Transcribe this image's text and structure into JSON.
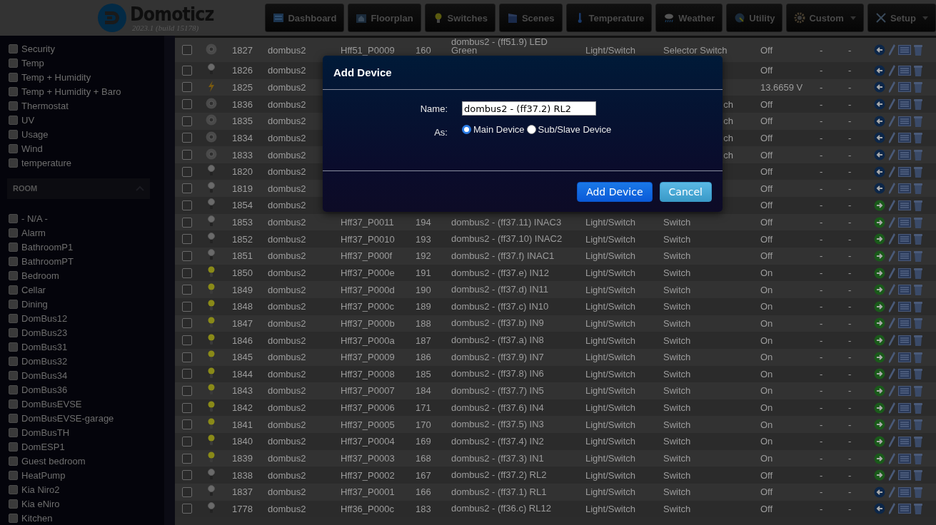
{
  "header": {
    "logo_text": "Domoticz",
    "version": "2023.1 (build 15178)",
    "nav": [
      {
        "label": "Dashboard",
        "kind": "dashboard",
        "dropdown": false
      },
      {
        "label": "Floorplan",
        "kind": "floorplan",
        "dropdown": false
      },
      {
        "label": "Switches",
        "kind": "switches",
        "dropdown": false
      },
      {
        "label": "Scenes",
        "kind": "scenes",
        "dropdown": false
      },
      {
        "label": "Temperature",
        "kind": "temperature",
        "dropdown": false
      },
      {
        "label": "Weather",
        "kind": "weather",
        "dropdown": false
      },
      {
        "label": "Utility",
        "kind": "utility",
        "dropdown": false
      },
      {
        "label": "Custom",
        "kind": "custom",
        "dropdown": true
      },
      {
        "label": "Setup",
        "kind": "setup",
        "dropdown": true
      }
    ]
  },
  "sidebar": {
    "type_items": [
      {
        "label": "Security",
        "checked": false
      },
      {
        "label": "Temp",
        "checked": false
      },
      {
        "label": "Temp + Humidity",
        "checked": false
      },
      {
        "label": "Temp + Humidity + Baro",
        "checked": false
      },
      {
        "label": "Thermostat",
        "checked": false
      },
      {
        "label": "UV",
        "checked": false
      },
      {
        "label": "Usage",
        "checked": false
      },
      {
        "label": "Wind",
        "checked": false
      },
      {
        "label": "temperature",
        "checked": false
      }
    ],
    "room_section": {
      "title": "ROOM",
      "expanded": true
    },
    "room_items": [
      {
        "label": "- N/A -",
        "checked": false
      },
      {
        "label": "Alarm",
        "checked": false
      },
      {
        "label": "BathroomP1",
        "checked": false
      },
      {
        "label": "BathroomPT",
        "checked": false
      },
      {
        "label": "Bedroom",
        "checked": false
      },
      {
        "label": "Cellar",
        "checked": false
      },
      {
        "label": "Dining",
        "checked": false
      },
      {
        "label": "DomBus12",
        "checked": false
      },
      {
        "label": "DomBus23",
        "checked": false
      },
      {
        "label": "DomBus31",
        "checked": false
      },
      {
        "label": "DomBus32",
        "checked": false
      },
      {
        "label": "DomBus34",
        "checked": false
      },
      {
        "label": "DomBus36",
        "checked": false
      },
      {
        "label": "DomBusEVSE",
        "checked": false
      },
      {
        "label": "DomBusEVSE-garage",
        "checked": false
      },
      {
        "label": "DomBusTH",
        "checked": false
      },
      {
        "label": "DomESP1",
        "checked": false
      },
      {
        "label": "Guest bedroom",
        "checked": false
      },
      {
        "label": "HeatPump",
        "checked": false
      },
      {
        "label": "Kia Niro2",
        "checked": false
      },
      {
        "label": "Kia eNiro",
        "checked": false
      },
      {
        "label": "Kitchen",
        "checked": false
      }
    ]
  },
  "table": {
    "rows": [
      {
        "checked": false,
        "kind": "selector",
        "idx": "1827",
        "hardware": "dombus2",
        "id": "Hff51_P0009",
        "unit": "160",
        "name": "dombus2 - (ff51.9) LED Green",
        "type": "Light/Switch",
        "subtype": "Selector Switch",
        "data": "Off",
        "column_11": "-",
        "column_12": "-",
        "used": true
      },
      {
        "checked": false,
        "kind": "bulb_off",
        "idx": "1826",
        "hardware": "dombus2",
        "data": "Off",
        "column_11": "-",
        "column_12": "-",
        "used": true
      },
      {
        "checked": false,
        "kind": "bolt",
        "idx": "1825",
        "hardware": "dombus2",
        "data": "13.6659 V",
        "column_11": "-",
        "column_12": "-",
        "used": true
      },
      {
        "checked": false,
        "kind": "selector",
        "idx": "1836",
        "hardware": "dombus2",
        "subtype_tail": "ch",
        "data": "Off",
        "column_11": "-",
        "column_12": "-",
        "used": true
      },
      {
        "checked": false,
        "kind": "selector",
        "idx": "1835",
        "hardware": "dombus2",
        "subtype_tail": "ch",
        "data": "Off",
        "column_11": "-",
        "column_12": "-",
        "used": true
      },
      {
        "checked": false,
        "kind": "selector",
        "idx": "1834",
        "hardware": "dombus2",
        "subtype_tail": "ch",
        "data": "Off",
        "column_11": "-",
        "column_12": "-",
        "used": true
      },
      {
        "checked": false,
        "kind": "selector",
        "idx": "1833",
        "hardware": "dombus2",
        "subtype_tail": "ch",
        "data": "Off",
        "column_11": "-",
        "column_12": "-",
        "used": true
      },
      {
        "checked": false,
        "kind": "bulb_off",
        "idx": "1820",
        "hardware": "dombus2",
        "data": "Off",
        "column_11": "-",
        "column_12": "-",
        "used": true
      },
      {
        "checked": false,
        "kind": "bulb_off",
        "idx": "1819",
        "hardware": "dombus2",
        "data": "Off",
        "column_11": "-",
        "column_12": "-",
        "used": true
      },
      {
        "checked": false,
        "kind": "bulb_off",
        "idx": "1854",
        "hardware": "dombus2",
        "data": "Off",
        "column_11": "-",
        "column_12": "-",
        "used": false
      },
      {
        "checked": false,
        "kind": "bulb_off",
        "idx": "1853",
        "hardware": "dombus2",
        "id": "Hff37_P0011",
        "unit": "194",
        "name": "dombus2 - (ff37.11) INAC3",
        "type": "Light/Switch",
        "subtype": "Switch",
        "data": "Off",
        "column_11": "-",
        "column_12": "-",
        "used": false
      },
      {
        "checked": false,
        "kind": "bulb_off",
        "idx": "1852",
        "hardware": "dombus2",
        "id": "Hff37_P0010",
        "unit": "193",
        "name": "dombus2 - (ff37.10) INAC2",
        "type": "Light/Switch",
        "subtype": "Switch",
        "data": "Off",
        "column_11": "-",
        "column_12": "-",
        "used": false
      },
      {
        "checked": false,
        "kind": "bulb_off",
        "idx": "1851",
        "hardware": "dombus2",
        "id": "Hff37_P000f",
        "unit": "192",
        "name": "dombus2 - (ff37.f) INAC1",
        "type": "Light/Switch",
        "subtype": "Switch",
        "data": "Off",
        "column_11": "-",
        "column_12": "-",
        "used": false
      },
      {
        "checked": false,
        "kind": "bulb_on",
        "idx": "1850",
        "hardware": "dombus2",
        "id": "Hff37_P000e",
        "unit": "191",
        "name": "dombus2 - (ff37.e) IN12",
        "type": "Light/Switch",
        "subtype": "Switch",
        "data": "On",
        "column_11": "-",
        "column_12": "-",
        "used": false
      },
      {
        "checked": false,
        "kind": "bulb_on",
        "idx": "1849",
        "hardware": "dombus2",
        "id": "Hff37_P000d",
        "unit": "190",
        "name": "dombus2 - (ff37.d) IN11",
        "type": "Light/Switch",
        "subtype": "Switch",
        "data": "On",
        "column_11": "-",
        "column_12": "-",
        "used": false
      },
      {
        "checked": false,
        "kind": "bulb_on",
        "idx": "1848",
        "hardware": "dombus2",
        "id": "Hff37_P000c",
        "unit": "189",
        "name": "dombus2 - (ff37.c) IN10",
        "type": "Light/Switch",
        "subtype": "Switch",
        "data": "On",
        "column_11": "-",
        "column_12": "-",
        "used": false
      },
      {
        "checked": false,
        "kind": "bulb_on",
        "idx": "1847",
        "hardware": "dombus2",
        "id": "Hff37_P000b",
        "unit": "188",
        "name": "dombus2 - (ff37.b) IN9",
        "type": "Light/Switch",
        "subtype": "Switch",
        "data": "On",
        "column_11": "-",
        "column_12": "-",
        "used": false
      },
      {
        "checked": false,
        "kind": "bulb_on",
        "idx": "1846",
        "hardware": "dombus2",
        "id": "Hff37_P000a",
        "unit": "187",
        "name": "dombus2 - (ff37.a) IN8",
        "type": "Light/Switch",
        "subtype": "Switch",
        "data": "On",
        "column_11": "-",
        "column_12": "-",
        "used": false
      },
      {
        "checked": false,
        "kind": "bulb_on",
        "idx": "1845",
        "hardware": "dombus2",
        "id": "Hff37_P0009",
        "unit": "186",
        "name": "dombus2 - (ff37.9) IN7",
        "type": "Light/Switch",
        "subtype": "Switch",
        "data": "On",
        "column_11": "-",
        "column_12": "-",
        "used": false
      },
      {
        "checked": false,
        "kind": "bulb_on",
        "idx": "1844",
        "hardware": "dombus2",
        "id": "Hff37_P0008",
        "unit": "185",
        "name": "dombus2 - (ff37.8) IN6",
        "type": "Light/Switch",
        "subtype": "Switch",
        "data": "On",
        "column_11": "-",
        "column_12": "-",
        "used": false
      },
      {
        "checked": false,
        "kind": "bulb_on",
        "idx": "1843",
        "hardware": "dombus2",
        "id": "Hff37_P0007",
        "unit": "184",
        "name": "dombus2 - (ff37.7) IN5",
        "type": "Light/Switch",
        "subtype": "Switch",
        "data": "On",
        "column_11": "-",
        "column_12": "-",
        "used": false
      },
      {
        "checked": false,
        "kind": "bulb_on",
        "idx": "1842",
        "hardware": "dombus2",
        "id": "Hff37_P0006",
        "unit": "171",
        "name": "dombus2 - (ff37.6) IN4",
        "type": "Light/Switch",
        "subtype": "Switch",
        "data": "On",
        "column_11": "-",
        "column_12": "-",
        "used": false
      },
      {
        "checked": false,
        "kind": "bulb_on",
        "idx": "1841",
        "hardware": "dombus2",
        "id": "Hff37_P0005",
        "unit": "170",
        "name": "dombus2 - (ff37.5) IN3",
        "type": "Light/Switch",
        "subtype": "Switch",
        "data": "On",
        "column_11": "-",
        "column_12": "-",
        "used": false
      },
      {
        "checked": false,
        "kind": "bulb_on",
        "idx": "1840",
        "hardware": "dombus2",
        "id": "Hff37_P0004",
        "unit": "169",
        "name": "dombus2 - (ff37.4) IN2",
        "type": "Light/Switch",
        "subtype": "Switch",
        "data": "On",
        "column_11": "-",
        "column_12": "-",
        "used": false
      },
      {
        "checked": false,
        "kind": "bulb_on",
        "idx": "1839",
        "hardware": "dombus2",
        "id": "Hff37_P0003",
        "unit": "168",
        "name": "dombus2 - (ff37.3) IN1",
        "type": "Light/Switch",
        "subtype": "Switch",
        "data": "On",
        "column_11": "-",
        "column_12": "-",
        "used": false
      },
      {
        "checked": false,
        "kind": "bulb_off",
        "idx": "1838",
        "hardware": "dombus2",
        "id": "Hff37_P0002",
        "unit": "167",
        "name": "dombus2 - (ff37.2) RL2",
        "type": "Light/Switch",
        "subtype": "Switch",
        "data": "Off",
        "column_11": "-",
        "column_12": "-",
        "used": false
      },
      {
        "checked": false,
        "kind": "bulb_off",
        "idx": "1837",
        "hardware": "dombus2",
        "id": "Hff37_P0001",
        "unit": "166",
        "name": "dombus2 - (ff37.1) RL1",
        "type": "Light/Switch",
        "subtype": "Switch",
        "data": "Off",
        "column_11": "-",
        "column_12": "-",
        "used": true
      },
      {
        "checked": false,
        "kind": "bulb_off",
        "idx": "1778",
        "hardware": "dombus2",
        "id": "Hff36_P000c",
        "unit": "183",
        "name": "dombus2 - (ff36.c) RL12",
        "type": "Light/Switch",
        "subtype": "Switch",
        "data": "Off",
        "column_11": "-",
        "column_12": "-",
        "used": true
      }
    ]
  },
  "dialog": {
    "title": "Add Device",
    "name_label": "Name:",
    "name_value": "dombus2 - (ff37.2) RL2",
    "as_label": "As:",
    "options": [
      {
        "label": "Main Device",
        "selected": true
      },
      {
        "label": "Sub/Slave Device",
        "selected": false
      }
    ],
    "buttons": [
      {
        "label": "Add Device",
        "kind": "primary"
      },
      {
        "label": "Cancel",
        "kind": "secondary"
      }
    ]
  }
}
